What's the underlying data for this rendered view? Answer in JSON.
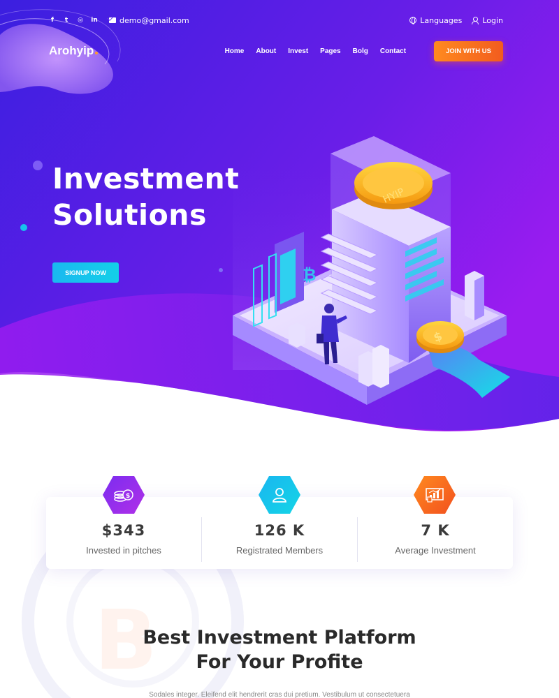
{
  "topbar": {
    "socials": [
      {
        "icon": "facebook-icon",
        "glyph": "f"
      },
      {
        "icon": "twitter-icon",
        "glyph": "t"
      },
      {
        "icon": "instagram-icon",
        "glyph": "◎"
      },
      {
        "icon": "linkedin-icon",
        "glyph": "in"
      }
    ],
    "email": "demo@gmail.com",
    "languages_label": "Languages",
    "login_label": "Login"
  },
  "nav": {
    "logo": "Arohyip",
    "items": [
      "Home",
      "About",
      "Invest",
      "Pages",
      "Bolg",
      "Contact"
    ],
    "join_label": "JOIN WITH US"
  },
  "hero": {
    "title_line1": "Investment",
    "title_line2": "Solutions",
    "signup_label": "SIGNUP NOW",
    "coin_label": "HYIP"
  },
  "stats": [
    {
      "value": "$343",
      "label": "Invested in pitches",
      "icon": "coins-icon",
      "color_from": "#7b2cf0",
      "color_to": "#b030e8"
    },
    {
      "value": "126 K",
      "label": "Registrated Members",
      "icon": "user-icon",
      "color_from": "#19b6f0",
      "color_to": "#14d5e6"
    },
    {
      "value": "7 K",
      "label": "Average Investment",
      "icon": "chart-icon",
      "color_from": "#ff8a1f",
      "color_to": "#f2501f"
    }
  ],
  "section": {
    "title_line1": "Best Investment Platform",
    "title_line2": "For Your Profite",
    "text": "Sodales integer. Eleifend elit hendrerit cras dui pretium. Vestibulum ut consectetuera"
  },
  "colors": {
    "hero_from": "#3d1ee0",
    "hero_to": "#9a1cf0",
    "accent_orange": "#ff8a1f",
    "accent_cyan": "#17c3ec"
  }
}
